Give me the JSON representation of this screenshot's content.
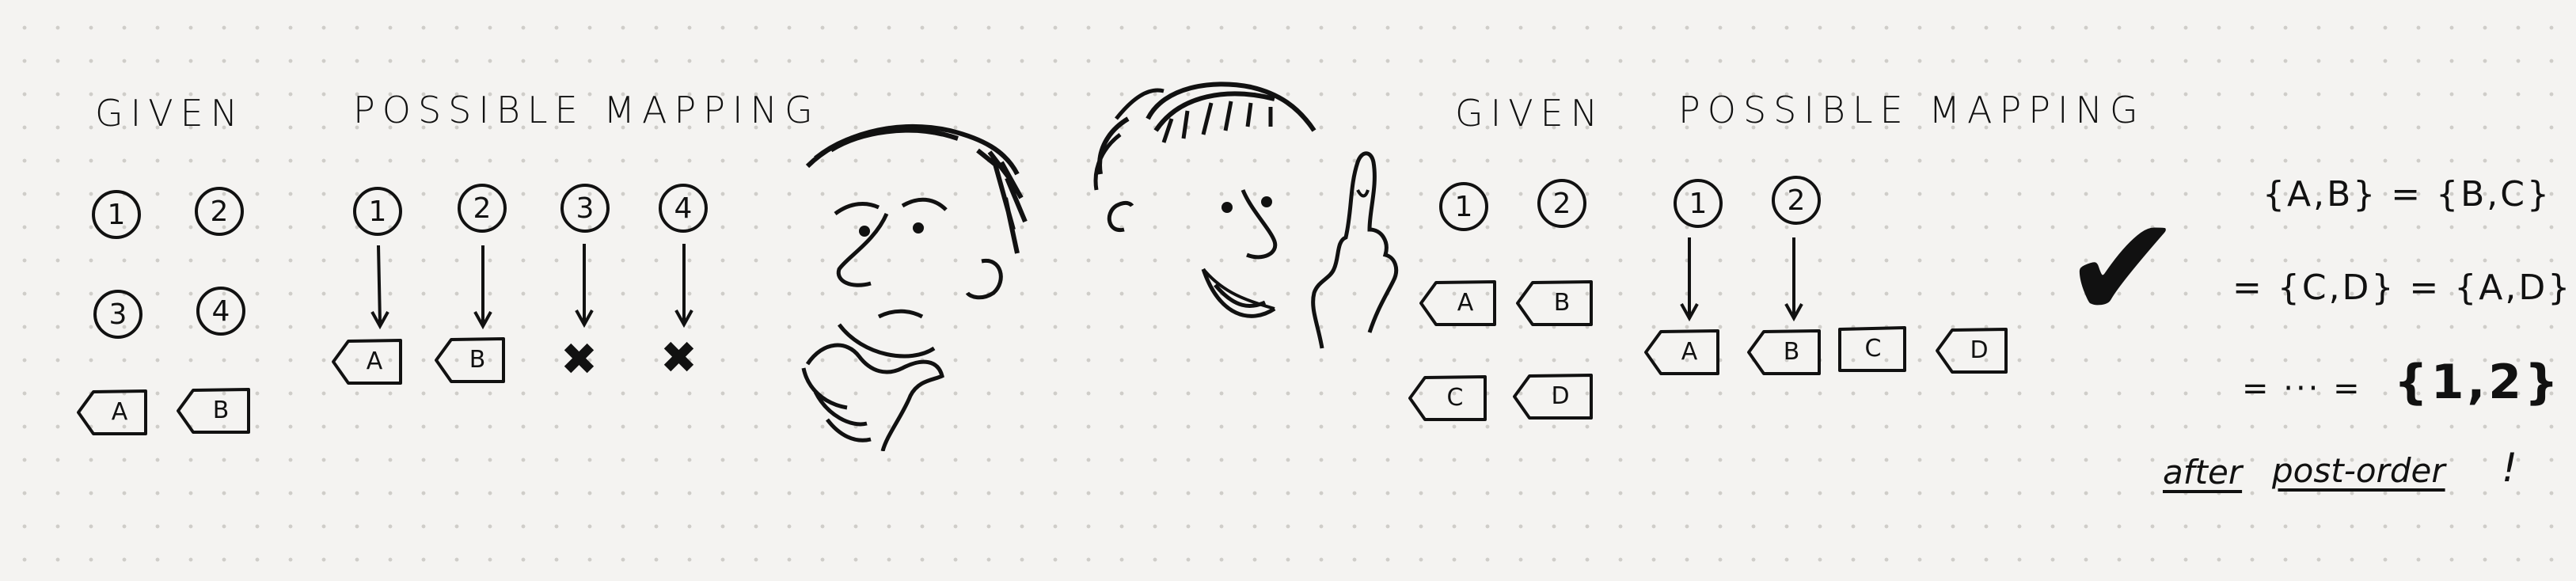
{
  "left_panel": {
    "given_label": "GIVEN",
    "mapping_label": "POSSIBLE MAPPING",
    "given_nodes": [
      "1",
      "2",
      "3",
      "4"
    ],
    "given_tags": [
      "A",
      "B"
    ],
    "mapping_nodes": [
      "1",
      "2",
      "3",
      "4"
    ],
    "mapping_targets": [
      "A",
      "B",
      "✖",
      "✖"
    ]
  },
  "right_panel": {
    "given_label": "GIVEN",
    "mapping_label": "POSSIBLE MAPPING",
    "given_nodes": [
      "1",
      "2"
    ],
    "given_tags": [
      "A",
      "B",
      "C",
      "D"
    ],
    "mapping_nodes": [
      "1",
      "2"
    ],
    "mapping_tags": [
      "A",
      "B",
      "C",
      "D"
    ]
  },
  "checkmark": "✔",
  "equations": {
    "line1": "{A,B} = {B,C}",
    "line2": "= {C,D} = {A,D}",
    "line3_prefix": "= ··· =",
    "line3_result": "{1,2}",
    "footer_word1": "after",
    "footer_word2": "post-order",
    "footer_bang": "!"
  },
  "colors": {
    "ink": "#111111",
    "paper": "#f4f3f1",
    "dot": "#cfcdc9"
  }
}
